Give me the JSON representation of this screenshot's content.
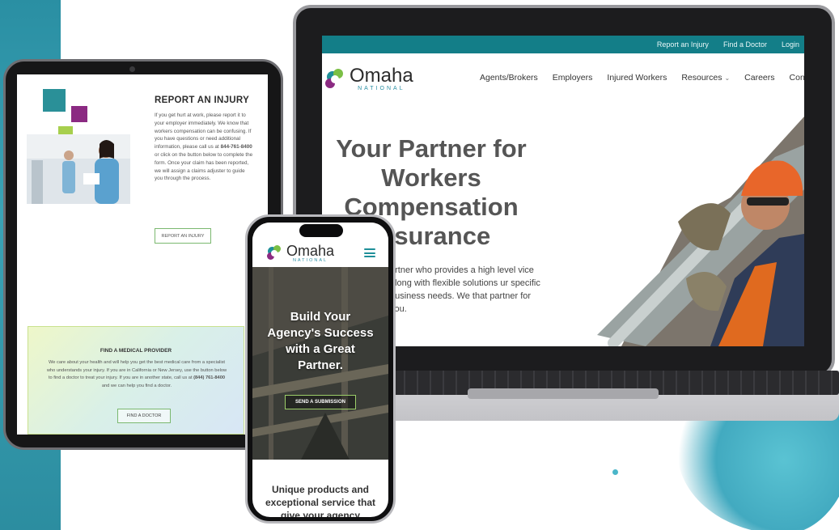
{
  "colors": {
    "teal": "#137e88",
    "accent_green": "#7bb86f",
    "background_blue": "#2a8fa3"
  },
  "laptop": {
    "topbar": {
      "links": [
        "Report an Injury",
        "Find a Doctor",
        "Login"
      ]
    },
    "logo": {
      "name": "Omaha",
      "sub": "NATIONAL"
    },
    "nav": [
      "Agents/Brokers",
      "Employers",
      "Injured Workers",
      "Resources",
      "Careers",
      "Conta"
    ],
    "hero": {
      "title_lines": [
        "Your Partner for",
        "Workers",
        "Compensation",
        "Insurance"
      ],
      "text": "artner who provides a high level vice along with flexible solutions ur specific business needs. We that partner for you."
    }
  },
  "tablet": {
    "heading": "REPORT AN INJURY",
    "body_before": "If you get hurt at work, please report it to your employer immediately. We know that workers compensation can be confusing. If you have questions or need additional information, please call us at ",
    "phone": "844-761-8400",
    "body_after": " or click on the button below to complete the form. Once your claim has been reported, we will assign a claims adjuster to guide you through the process.",
    "button": "REPORT AN INJURY",
    "card": {
      "title": "FIND A MEDICAL PROVIDER",
      "body_before": "We care about your health and will help you get the best medical care from a specialist who understands your injury. If you are in California or New Jersey, use the button below to find a doctor to treat your injury. If you are in another state, call us at ",
      "phone": "(844) 761-8400",
      "body_after": " and we can help you find a doctor.",
      "button": "FIND A DOCTOR"
    }
  },
  "phone": {
    "logo": {
      "name": "Omaha",
      "sub": "NATIONAL"
    },
    "hero_title": "Build Your Agency's Success with a Great Partner.",
    "button": "SEND A SUBMISSION",
    "bottom_text": "Unique products and exceptional service that give your agency"
  }
}
